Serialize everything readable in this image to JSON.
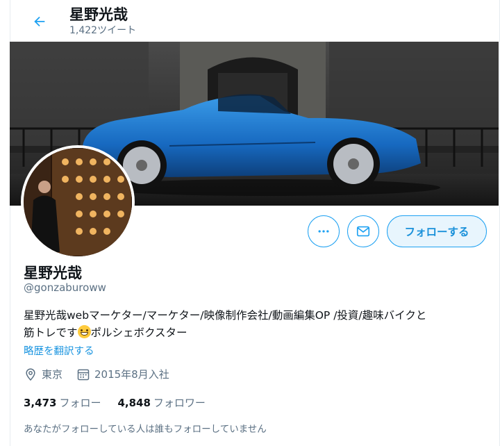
{
  "header": {
    "title": "星野光哉",
    "tweet_count": "1,422ツイート"
  },
  "profile": {
    "name": "星野光哉",
    "handle": "@gonzaburoww",
    "bio_line1": "星野光哉webマーケター/マーケター/映像制作会社/動画編集OP /投資/趣味バイクと",
    "bio_line2_pre": "筋トレです",
    "bio_line2_post": "ポルシェボクスター",
    "translate_link": "略歴を翻訳する",
    "location": "東京",
    "joined": "2015年8月入社",
    "following_count": "3,473",
    "following_label": "フォロー",
    "followers_count": "4,848",
    "followers_label": "フォロワー",
    "mutual_note": "あなたがフォローしている人は誰もフォローしていません"
  },
  "actions": {
    "follow_label": "フォローする"
  },
  "icons": [
    "back-arrow-icon",
    "more-icon",
    "message-icon",
    "location-pin-icon",
    "calendar-icon"
  ],
  "colors": {
    "accent": "#1da1f2",
    "text_secondary": "#5b7083",
    "link": "#1b95e0"
  }
}
